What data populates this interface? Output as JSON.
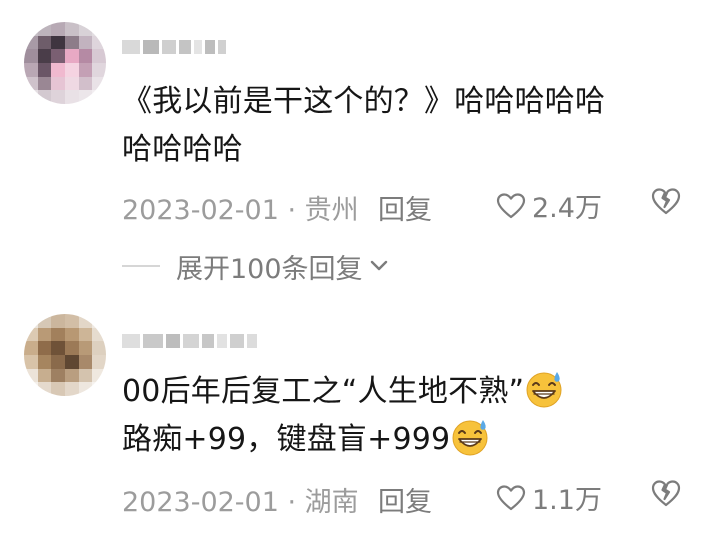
{
  "comments": [
    {
      "text_line1": "《我以前是干这个的？》哈哈哈哈哈",
      "text_line2": "哈哈哈哈",
      "date_location": "2023-02-01 · 贵州",
      "reply_label": "回复",
      "like_count": "2.4万",
      "expand_label": "展开100条回复"
    },
    {
      "text_line1": "00后年后复工之“人生地不熟”",
      "text_line2": "路痴+99，键盘盲+999",
      "date_location": "2023-02-01 · 湖南",
      "reply_label": "回复",
      "like_count": "1.1万"
    }
  ],
  "icons": {
    "like": "heart-outline-icon",
    "dislike": "broken-heart-icon",
    "expand": "chevron-down-icon",
    "emoji": "sweat-grin-emoji-icon"
  },
  "colors": {
    "text": "#161616",
    "meta": "#9c9c9c",
    "action": "#7c7c7c",
    "emoji_face": "#f7c23b",
    "emoji_drop": "#5aa9e6"
  }
}
